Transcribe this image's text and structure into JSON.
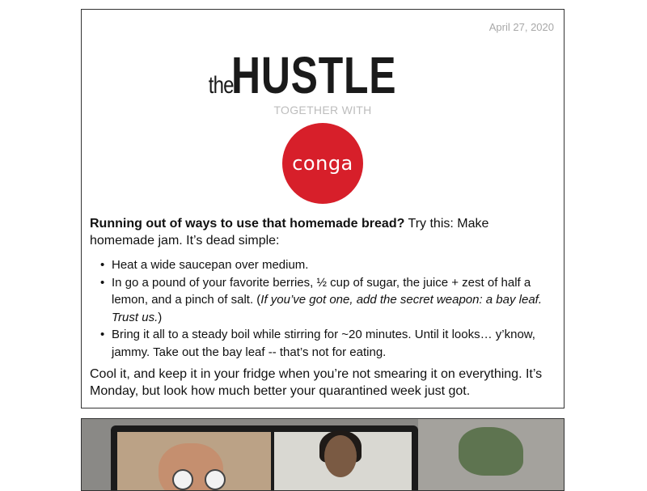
{
  "newsletter": {
    "date": "April 27, 2020",
    "brand": {
      "the": "the",
      "name": "HUSTLE"
    },
    "together_with": "TOGETHER WITH",
    "sponsor": {
      "name": "conga",
      "color": "#d71f2a"
    },
    "intro_bold": "Running out of ways to use that homemade bread?",
    "intro_rest": " Try this: Make homemade jam. It’s dead simple:",
    "steps": {
      "s1": "Heat a wide saucepan over medium.",
      "s2_text": "In go a pound of your favorite berries, ½ cup of sugar, the juice + zest of half a lemon, and a pinch of salt. (",
      "s2_italic": "If you’ve got one, add the secret weapon: a bay leaf. Trust us.",
      "s2_close": ")",
      "s3": "Bring it all to a steady boil while stirring for ~20 minutes. Until it looks… y’know, jammy. Take out the bay leaf -- that’s not for eating."
    },
    "outro": "Cool it, and keep it in your fridge when you’re not smearing it on everything. It’s Monday, but look how much better your quarantined week just got."
  }
}
